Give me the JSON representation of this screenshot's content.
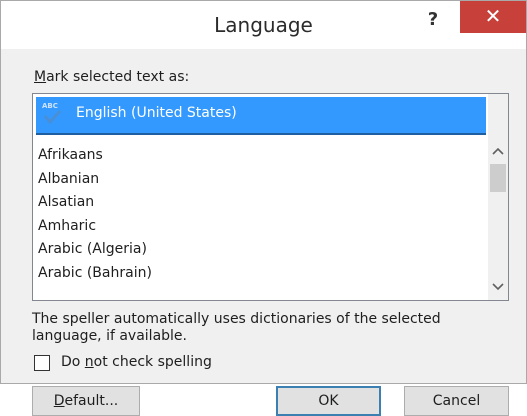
{
  "window": {
    "title": "Language",
    "help_label": "?",
    "close_label": "✕"
  },
  "dialog": {
    "mark_label_pre": "Mark selected text as:",
    "selected_language": "English (United States)",
    "languages": [
      "Afrikaans",
      "Albanian",
      "Alsatian",
      "Amharic",
      "Arabic (Algeria)",
      "Arabic (Bahrain)"
    ],
    "info_text": "The speller automatically uses dictionaries of the selected language, if available.",
    "checkbox_label_pre": "Do ",
    "checkbox_label_u": "n",
    "checkbox_label_post": "ot check spelling",
    "checkbox_checked": false
  },
  "buttons": {
    "default_u": "D",
    "default_post": "efault...",
    "ok": "OK",
    "cancel": "Cancel"
  },
  "icons": {
    "selected_row_icon": "spellcheck-abc-icon",
    "scroll_up": "chevron-up-icon",
    "scroll_down": "chevron-down-icon"
  },
  "colors": {
    "selection": "#3399ff",
    "close": "#c7403a",
    "ok_border": "#3c7fb1"
  }
}
